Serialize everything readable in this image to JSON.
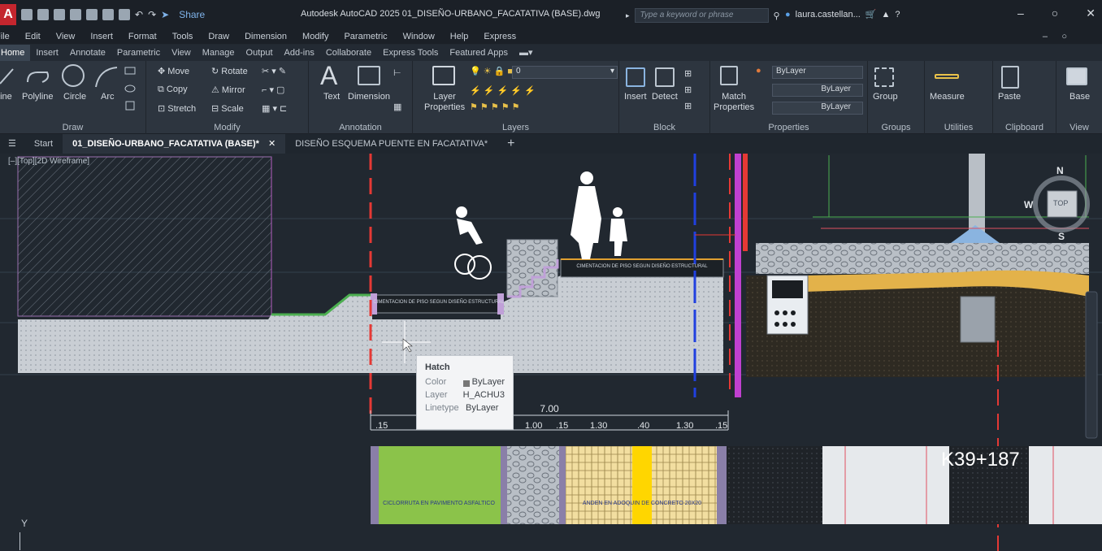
{
  "titlebar": {
    "logo": "A",
    "share": "Share",
    "title": "Autodesk AutoCAD 2025   01_DISEÑO-URBANO_FACATATIVA (BASE).dwg",
    "search_placeholder": "Type a keyword or phrase",
    "user": "laura.castellan..."
  },
  "menu": [
    "File",
    "Edit",
    "View",
    "Insert",
    "Format",
    "Tools",
    "Draw",
    "Dimension",
    "Modify",
    "Parametric",
    "Window",
    "Help",
    "Express"
  ],
  "ribbon_tabs": [
    "Home",
    "Insert",
    "Annotate",
    "Parametric",
    "View",
    "Manage",
    "Output",
    "Add-ins",
    "Collaborate",
    "Express Tools",
    "Featured Apps"
  ],
  "ribbon": {
    "draw": {
      "title": "Draw",
      "line": "Line",
      "polyline": "Polyline",
      "circle": "Circle",
      "arc": "Arc"
    },
    "modify": {
      "title": "Modify",
      "move": "Move",
      "rotate": "Rotate",
      "copy": "Copy",
      "mirror": "Mirror",
      "stretch": "Stretch",
      "scale": "Scale"
    },
    "annotation": {
      "title": "Annotation",
      "text": "Text",
      "dimension": "Dimension"
    },
    "layers": {
      "title": "Layers",
      "layer_properties_1": "Layer",
      "layer_properties_2": "Properties",
      "current_layer": "0"
    },
    "block": {
      "title": "Block",
      "insert": "Insert",
      "detect": "Detect"
    },
    "properties": {
      "title": "Properties",
      "match_1": "Match",
      "match_2": "Properties",
      "color": "ByLayer",
      "linetype": "ByLayer",
      "lineweight": "ByLayer"
    },
    "groups": {
      "title": "Groups",
      "group": "Group"
    },
    "utilities": {
      "title": "Utilities",
      "measure": "Measure"
    },
    "clipboard": {
      "title": "Clipboard",
      "paste": "Paste"
    },
    "view": {
      "title": "View",
      "base": "Base"
    }
  },
  "doc_tabs": {
    "start": "Start",
    "active": "01_DISEÑO-URBANO_FACATATIVA (BASE)*",
    "second": "DISEÑO ESQUEMA PUENTE EN FACATATIVA*",
    "add": "+"
  },
  "viewport": {
    "label": "[–][Top][2D Wireframe]",
    "ucs_y": "Y"
  },
  "viewcube": {
    "north": "N",
    "south": "S",
    "west": "W",
    "top": "TOP"
  },
  "drawing": {
    "label_cimentacion_1": "CIMENTACION DE PISO SEGUN DISEÑO ESTRUCTURAL",
    "label_cimentacion_2": "CIMENTACION DE PISO SEGUN DISEÑO ESTRUCTURAL",
    "dim_total": "7.00",
    "dims": [
      ".15",
      "1.00",
      ".15",
      "1.30",
      ".40",
      "1.30",
      ".15"
    ],
    "legend_ciclorruta": "CICLORRUTA EN PAVIMENTO ASFALTICO",
    "legend_anden": "ANDEN EN ADOQUIN DE CONCRETO 20X20",
    "station": "K39+187"
  },
  "tooltip": {
    "title": "Hatch",
    "color_label": "Color",
    "color_value": "ByLayer",
    "layer_label": "Layer",
    "layer_value": "H_ACHU3",
    "linetype_label": "Linetype",
    "linetype_value": "ByLayer"
  }
}
